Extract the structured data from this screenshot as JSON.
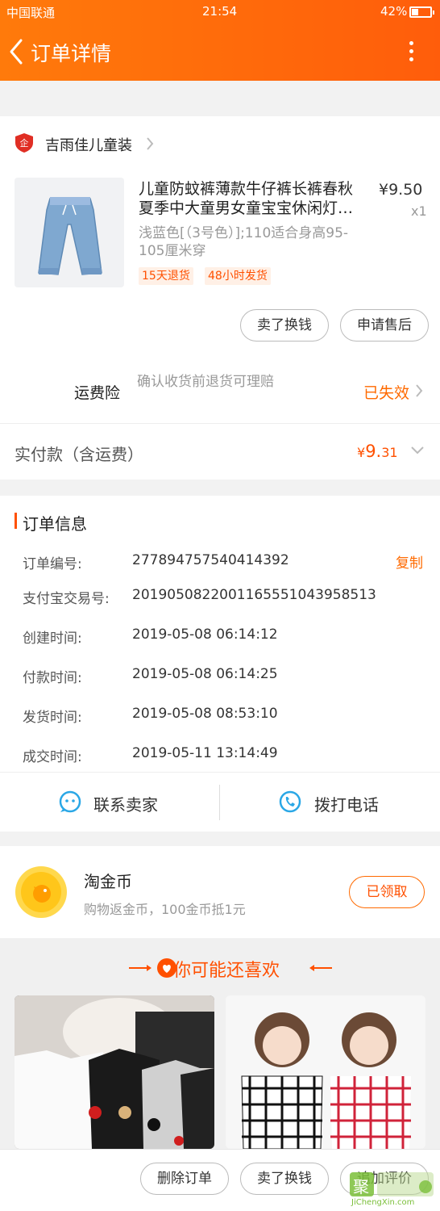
{
  "status_bar": {
    "carrier": "中国联通",
    "time": "21:54",
    "battery": "42%"
  },
  "header": {
    "title": "订单详情"
  },
  "shop": {
    "name": "吉雨佳儿童装"
  },
  "product": {
    "title": "儿童防蚊裤薄款牛仔裤长裤春秋夏季中大童男女童宝宝休闲灯…",
    "price": "¥9.50",
    "quantity": "x1",
    "sku": "浅蓝色[（3号色）];110适合身高95-105厘米穿",
    "tags": [
      "15天退货",
      "48小时发货"
    ]
  },
  "actions": {
    "exchange_label": "卖了换钱",
    "after_sale_label": "申请售后"
  },
  "insurance": {
    "label": "运费险",
    "desc": "确认收货前退货可理赔",
    "status": "已失效"
  },
  "payment": {
    "label": "实付款（含运费）",
    "currency": "¥",
    "amount_int": "9.",
    "amount_dec": "31"
  },
  "order_info": {
    "title": "订单信息",
    "copy_label": "复制",
    "rows": [
      {
        "label": "订单编号:",
        "value": "277894757540414392"
      },
      {
        "label": "支付宝交易号:",
        "value": "2019050822001165551043958513"
      },
      {
        "label": "创建时间:",
        "value": "2019-05-08 06:14:12"
      },
      {
        "label": "付款时间:",
        "value": "2019-05-08 06:14:25"
      },
      {
        "label": "发货时间:",
        "value": "2019-05-08 08:53:10"
      },
      {
        "label": "成交时间:",
        "value": "2019-05-11 13:14:49"
      }
    ]
  },
  "contact": {
    "seller_label": "联系卖家",
    "phone_label": "拨打电话"
  },
  "coins": {
    "title": "淘金币",
    "desc": "购物返金币，100金币抵1元",
    "button": "已领取"
  },
  "recommend": {
    "title": "你可能还喜欢"
  },
  "bottom_bar": {
    "delete_label": "删除订单",
    "exchange_label": "卖了换钱",
    "review_label": "追加评价"
  },
  "watermark": {
    "logo": "聚",
    "brand": "JiChengXin.com"
  },
  "colors": {
    "brand_orange": "#ff5000",
    "header_start": "#ff7a0b",
    "header_end": "#ff5d0b",
    "icon_blue": "#2aa7e6"
  }
}
